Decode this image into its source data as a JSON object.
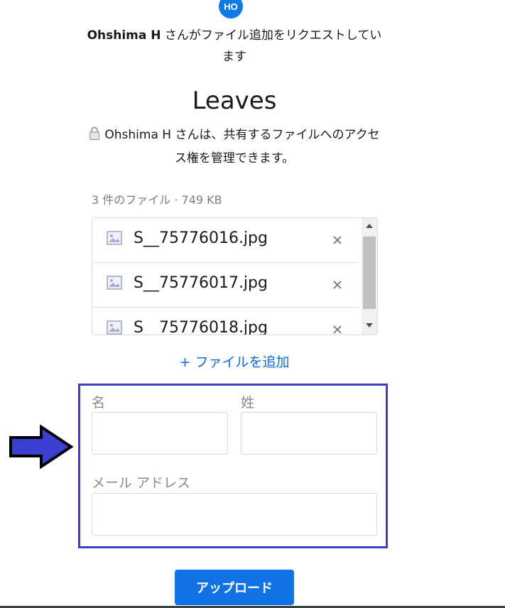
{
  "requester": {
    "avatar_initials": "HO",
    "name": "Ohshima H",
    "request_line": " さんがファイル追加をリクエストしています"
  },
  "folder_title": "Leaves",
  "access_note": "Ohshima H さんは、共有するファイルへのアクセス権を管理できます。",
  "files": {
    "summary": "3 件のファイル · 749 KB",
    "items": [
      {
        "name": "S__75776016.jpg"
      },
      {
        "name": "S__75776017.jpg"
      },
      {
        "name": "S__75776018.jpg"
      }
    ]
  },
  "add_file_label": "+ ファイルを追加",
  "form": {
    "first_name_label": "名",
    "last_name_label": "姓",
    "email_label": "メール アドレス",
    "first_name_value": "",
    "last_name_value": "",
    "email_value": ""
  },
  "upload_label": "アップロード",
  "colors": {
    "accent": "#0f73e6",
    "highlight_border": "#3f3fc0",
    "arrow_fill": "#3a3fd0"
  },
  "icons": [
    "lock-icon",
    "image-file-icon",
    "close-icon",
    "arrow-right-icon"
  ]
}
